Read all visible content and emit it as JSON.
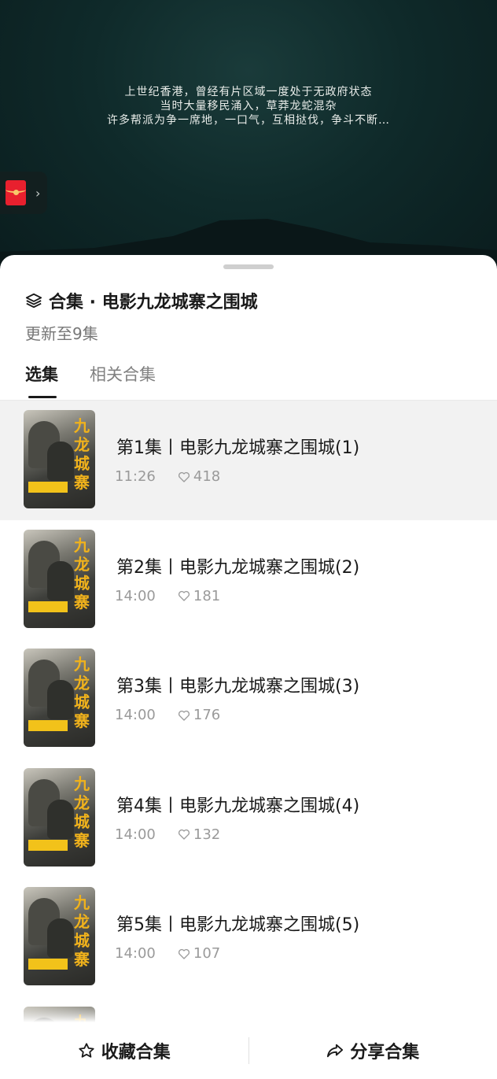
{
  "video": {
    "subtitle_lines": [
      "上世纪香港，曾经有片区域一度处于无政府状态",
      "当时大量移民涌入，草莽龙蛇混杂",
      "许多帮派为争一席地，一口气，互相挞伐，争斗不断…"
    ]
  },
  "sheet": {
    "title": "合集 · 电影九龙城寨之围城",
    "update_status": "更新至9集",
    "tabs": [
      {
        "label": "选集",
        "active": true
      },
      {
        "label": "相关合集",
        "active": false
      }
    ],
    "poster_kanji": "九龙城寨",
    "episodes": [
      {
        "title": "第1集丨电影九龙城寨之围城(1)",
        "duration": "11:26",
        "likes": "418",
        "selected": true
      },
      {
        "title": "第2集丨电影九龙城寨之围城(2)",
        "duration": "14:00",
        "likes": "181",
        "selected": false
      },
      {
        "title": "第3集丨电影九龙城寨之围城(3)",
        "duration": "14:00",
        "likes": "176",
        "selected": false
      },
      {
        "title": "第4集丨电影九龙城寨之围城(4)",
        "duration": "14:00",
        "likes": "132",
        "selected": false
      },
      {
        "title": "第5集丨电影九龙城寨之围城(5)",
        "duration": "14:00",
        "likes": "107",
        "selected": false
      },
      {
        "title": "",
        "duration": "",
        "likes": "",
        "selected": false
      }
    ]
  },
  "bottom_bar": {
    "favorite_label": "收藏合集",
    "share_label": "分享合集"
  },
  "colors": {
    "accent_poster": "#f0b21c",
    "video_bg": "#0f2a2a"
  }
}
